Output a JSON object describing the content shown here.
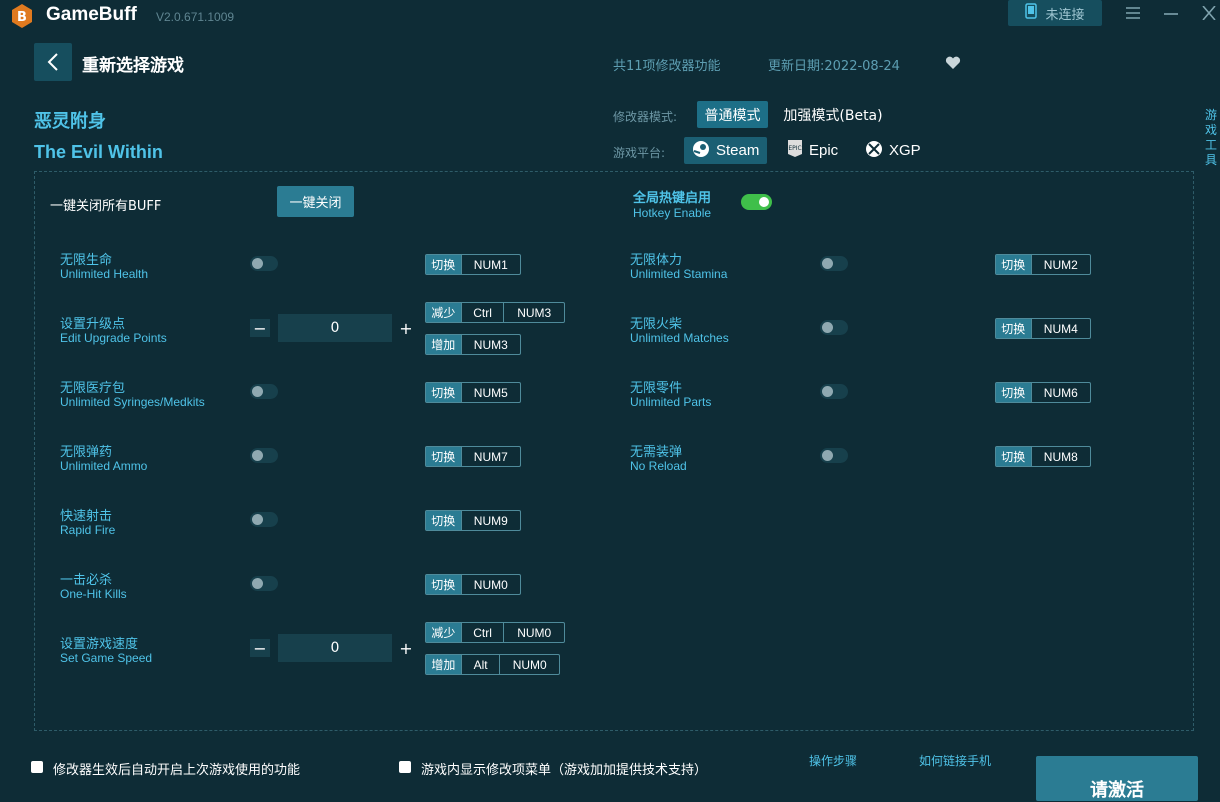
{
  "app": {
    "name": "GameBuff",
    "version": "V2.0.671.1009",
    "connect_label": "未连接"
  },
  "header": {
    "title": "重新选择游戏",
    "feature_count": "共11项修改器功能",
    "update_date": "更新日期:2022-08-24"
  },
  "game": {
    "name_cn": "恶灵附身",
    "name_en": "The Evil Within",
    "mode_label": "修改器模式:",
    "modes": [
      "普通模式",
      "加强模式(Beta)"
    ],
    "platform_label": "游戏平台:",
    "platforms": [
      "Steam",
      "Epic",
      "XGP"
    ]
  },
  "side_tab": [
    "游",
    "戏",
    "工",
    "具"
  ],
  "controls": {
    "close_all_label": "一键关闭所有BUFF",
    "close_all_button": "一键关闭",
    "hotkey_cn": "全局热键启用",
    "hotkey_en": "Hotkey Enable"
  },
  "hk_tags": {
    "toggle": "切换",
    "decrease": "减少",
    "increase": "增加"
  },
  "left_options": [
    {
      "cn": "无限生命",
      "en": "Unlimited Health",
      "type": "toggle",
      "keys": [
        "NUM1"
      ]
    },
    {
      "cn": "设置升级点",
      "en": "Edit Upgrade Points",
      "type": "number",
      "value": "0",
      "dec_keys": [
        "Ctrl",
        "NUM3"
      ],
      "inc_keys": [
        "NUM3"
      ]
    },
    {
      "cn": "无限医疗包",
      "en": "Unlimited Syringes/Medkits",
      "type": "toggle",
      "keys": [
        "NUM5"
      ]
    },
    {
      "cn": "无限弹药",
      "en": "Unlimited Ammo",
      "type": "toggle",
      "keys": [
        "NUM7"
      ]
    },
    {
      "cn": "快速射击",
      "en": "Rapid Fire",
      "type": "toggle",
      "keys": [
        "NUM9"
      ]
    },
    {
      "cn": "一击必杀",
      "en": "One-Hit Kills",
      "type": "toggle",
      "keys": [
        "NUM0"
      ]
    },
    {
      "cn": "设置游戏速度",
      "en": "Set Game Speed",
      "type": "number",
      "value": "0",
      "dec_keys": [
        "Ctrl",
        "NUM0"
      ],
      "inc_keys": [
        "Alt",
        "NUM0"
      ]
    }
  ],
  "right_options": [
    {
      "cn": "无限体力",
      "en": "Unlimited Stamina",
      "keys": [
        "NUM2"
      ]
    },
    {
      "cn": "无限火柴",
      "en": "Unlimited Matches",
      "keys": [
        "NUM4"
      ]
    },
    {
      "cn": "无限零件",
      "en": "Unlimited Parts",
      "keys": [
        "NUM6"
      ]
    },
    {
      "cn": "无需装弹",
      "en": "No Reload",
      "keys": [
        "NUM8"
      ]
    }
  ],
  "footer": {
    "auto_enable_label": "修改器生效后自动开启上次游戏使用的功能",
    "ingame_menu_label": "游戏内显示修改项菜单（游戏加加提供技术支持）",
    "steps_link": "操作步骤",
    "phone_link": "如何链接手机",
    "activate_button": "请激活"
  },
  "colors": {
    "background": "#0e2c36",
    "accent": "#4fc3e8",
    "button": "#2b7c93",
    "toggle_on": "#3fbf4a"
  }
}
